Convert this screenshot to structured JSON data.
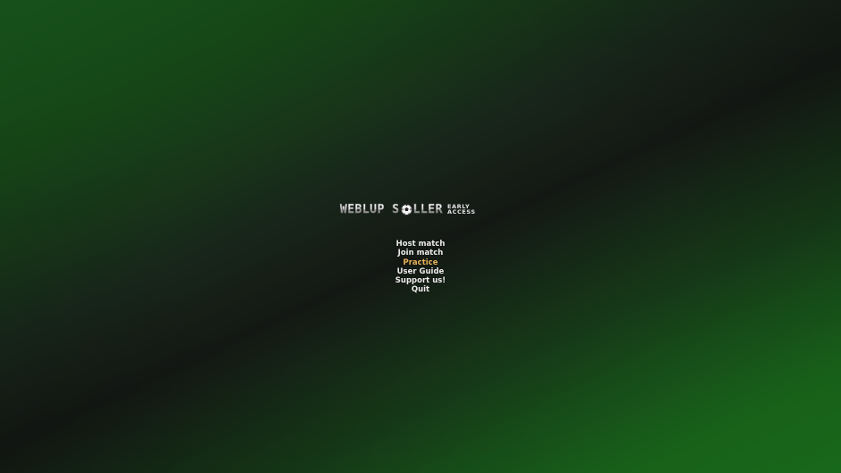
{
  "logo": {
    "word1": "WEBLUP S",
    "word2": "LLER",
    "tag_line1": "EARLY",
    "tag_line2": "ACCESS",
    "ball_icon": "soccer-ball-icon"
  },
  "menu": {
    "items": [
      {
        "label": "Host match"
      },
      {
        "label": "Join match"
      },
      {
        "label": "Practice"
      },
      {
        "label": "User Guide"
      },
      {
        "label": "Support us!"
      },
      {
        "label": "Quit"
      }
    ],
    "active_index": 2
  },
  "colors": {
    "menu_text": "#ececec",
    "menu_active": "#e9b25a",
    "background_green": "#1c7a1f",
    "background_dark": "#141814"
  }
}
